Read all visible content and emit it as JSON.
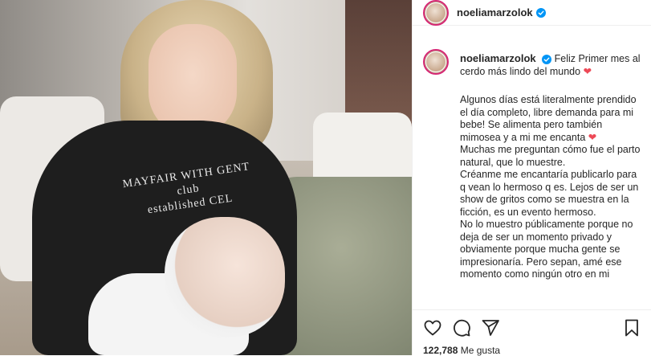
{
  "post": {
    "username": "noeliamarzolok",
    "likes_count": "122,788",
    "likes_label": "Me gusta"
  },
  "photo": {
    "sweater_print_line1": "MAYFAIR WITH GENT",
    "sweater_print_line2": "club",
    "sweater_print_line3": "established CEL"
  },
  "caption": {
    "line1": "Feliz Primer mes al cerdo más lindo del mundo",
    "para2": "Algunos días está literalmente prendido el día completo, libre demanda para mi bebe! Se alimenta pero también mimosea y a mi me encanta",
    "para3": "Muchas me preguntan cómo fue el parto natural, que lo muestre.",
    "para4": "Créanme me encantaría publicarlo para q vean lo hermoso q es. Lejos de ser un show de gritos como se muestra en la ficción, es un evento hermoso.",
    "para5": "No lo muestro públicamente porque no deja de ser un momento privado y obviamente porque mucha gente se impresionaría. Pero sepan, amé ese momento como ningún otro en mi"
  },
  "icons": {
    "heart_emoji": "❤",
    "verified": "verified-badge-icon",
    "like": "heart-icon",
    "comment": "comment-icon",
    "share": "paper-plane-icon",
    "save": "bookmark-icon"
  },
  "colors": {
    "verified_blue": "#0095f6",
    "heart_red": "#ed4956",
    "avatar_ring": "#d62976"
  }
}
